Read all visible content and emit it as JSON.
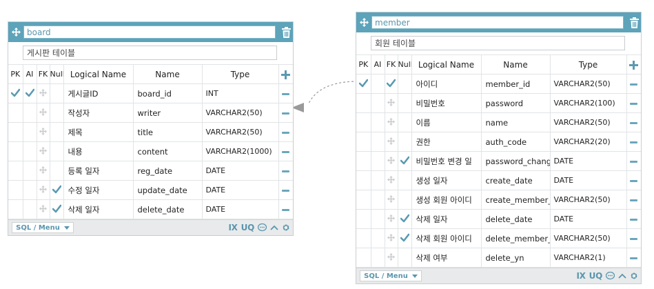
{
  "colors": {
    "accent": "#5da3ba",
    "check": "#5a9ab2",
    "icon_dim": "#c9cbcd"
  },
  "headers": {
    "pk": "PK",
    "ai": "AI",
    "fk": "FK",
    "null": "Null",
    "logical": "Logical Name",
    "name": "Name",
    "type": "Type"
  },
  "footer": {
    "sql_menu": "SQL / Menu",
    "ix": "IX",
    "uq": "UQ"
  },
  "board": {
    "name": "board",
    "comment": "게시판 테이블",
    "columns": [
      {
        "pk": true,
        "ai": true,
        "fk": false,
        "nullable": false,
        "logical": "게시글ID",
        "name": "board_id",
        "type": "INT"
      },
      {
        "pk": false,
        "ai": false,
        "fk": false,
        "nullable": false,
        "logical": "작성자",
        "name": "writer",
        "type": "VARCHAR2(50)"
      },
      {
        "pk": false,
        "ai": false,
        "fk": false,
        "nullable": false,
        "logical": "제목",
        "name": "title",
        "type": "VARCHAR2(50)"
      },
      {
        "pk": false,
        "ai": false,
        "fk": false,
        "nullable": false,
        "logical": "내용",
        "name": "content",
        "type": "VARCHAR2(1000)"
      },
      {
        "pk": false,
        "ai": false,
        "fk": false,
        "nullable": false,
        "logical": "등록 일자",
        "name": "reg_date",
        "type": "DATE"
      },
      {
        "pk": false,
        "ai": false,
        "fk": false,
        "nullable": true,
        "logical": "수정 일자",
        "name": "update_date",
        "type": "DATE"
      },
      {
        "pk": false,
        "ai": false,
        "fk": false,
        "nullable": true,
        "logical": "삭제 일자",
        "name": "delete_date",
        "type": "DATE"
      }
    ]
  },
  "member": {
    "name": "member",
    "comment": "회원 테이블",
    "columns": [
      {
        "pk": true,
        "ai": false,
        "fk": true,
        "nullable": false,
        "logical": "아이디",
        "name": "member_id",
        "type": "VARCHAR2(50)"
      },
      {
        "pk": false,
        "ai": false,
        "fk": false,
        "nullable": false,
        "logical": "비밀번호",
        "name": "password",
        "type": "VARCHAR2(100)"
      },
      {
        "pk": false,
        "ai": false,
        "fk": false,
        "nullable": false,
        "logical": "이름",
        "name": "name",
        "type": "VARCHAR2(50)"
      },
      {
        "pk": false,
        "ai": false,
        "fk": false,
        "nullable": false,
        "logical": "권한",
        "name": "auth_code",
        "type": "VARCHAR2(20)"
      },
      {
        "pk": false,
        "ai": false,
        "fk": false,
        "nullable": true,
        "logical": "비밀번호 변경 일",
        "name": "password_chang",
        "type": "DATE"
      },
      {
        "pk": false,
        "ai": false,
        "fk": false,
        "nullable": false,
        "logical": "생성 일자",
        "name": "create_date",
        "type": "DATE"
      },
      {
        "pk": false,
        "ai": false,
        "fk": false,
        "nullable": false,
        "logical": "생성 회원 아이디",
        "name": "create_member_",
        "type": "VARCHAR2(50)"
      },
      {
        "pk": false,
        "ai": false,
        "fk": false,
        "nullable": true,
        "logical": "삭제 일자",
        "name": "delete_date",
        "type": "DATE"
      },
      {
        "pk": false,
        "ai": false,
        "fk": false,
        "nullable": true,
        "logical": "삭제 회원 아이디",
        "name": "delete_member_",
        "type": "VARCHAR2(50)"
      },
      {
        "pk": false,
        "ai": false,
        "fk": false,
        "nullable": false,
        "logical": "삭제 여부",
        "name": "delete_yn",
        "type": "VARCHAR2(1)"
      }
    ]
  }
}
